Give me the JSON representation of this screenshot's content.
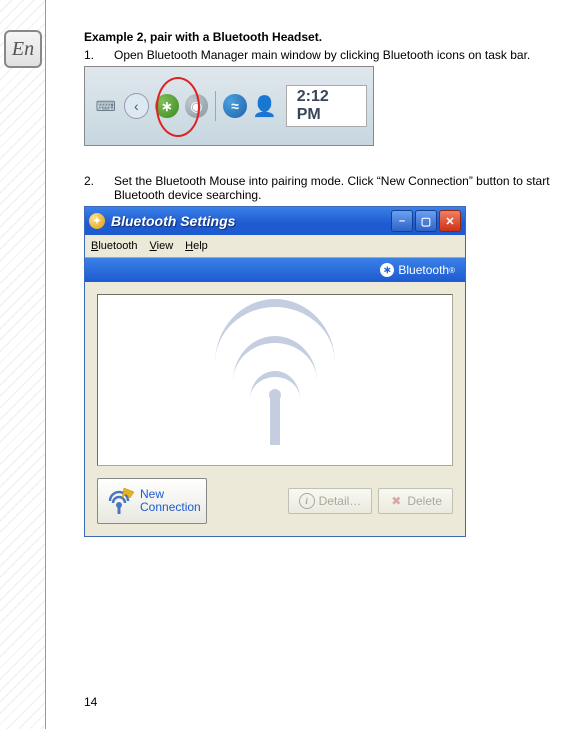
{
  "sidebar": {
    "badge_text": "En"
  },
  "doc": {
    "heading": "Example 2, pair with a Bluetooth Headset.",
    "steps": [
      {
        "num": "1.",
        "text": "Open Bluetooth Manager main window by clicking Bluetooth icons on task bar."
      },
      {
        "num": "2.",
        "text": "Set the Bluetooth Mouse into pairing mode. Click “New Connection” button to start Bluetooth device searching."
      }
    ],
    "page_number": "14"
  },
  "taskbar": {
    "clock": "2:12 PM"
  },
  "bt_window": {
    "title": "Bluetooth Settings",
    "menu": {
      "bluetooth": "Bluetooth",
      "view": "View",
      "help": "Help"
    },
    "brand": "Bluetooth",
    "buttons": {
      "new_connection": "New\nConnection",
      "detail": "Detail…",
      "delete": "Delete"
    }
  }
}
